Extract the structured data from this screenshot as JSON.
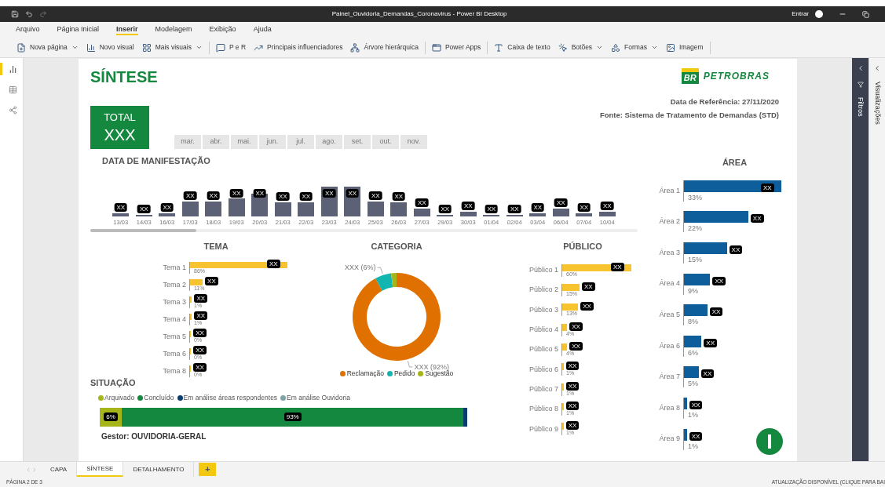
{
  "window": {
    "title": "Painel_Ouvidoria_Demandas_Coronavirus - Power BI Desktop",
    "account": "Entrar"
  },
  "menu": [
    {
      "label": "Arquivo",
      "selected": false
    },
    {
      "label": "Página Inicial",
      "selected": false
    },
    {
      "label": "Inserir",
      "selected": true
    },
    {
      "label": "Modelagem",
      "selected": false
    },
    {
      "label": "Exibição",
      "selected": false
    },
    {
      "label": "Ajuda",
      "selected": false
    }
  ],
  "ribbon": [
    {
      "label": "Nova página",
      "dropdown": true
    },
    {
      "label": "Novo visual",
      "dropdown": false
    },
    {
      "label": "Mais visuais",
      "dropdown": true
    },
    {
      "label": "P e R",
      "dropdown": false
    },
    {
      "label": "Principais influenciadores",
      "dropdown": false
    },
    {
      "label": "Árvore hierárquica",
      "dropdown": false
    },
    {
      "label": "Power Apps",
      "dropdown": false
    },
    {
      "label": "Caixa de texto",
      "dropdown": false
    },
    {
      "label": "Botões",
      "dropdown": true
    },
    {
      "label": "Formas",
      "dropdown": true
    },
    {
      "label": "Imagem",
      "dropdown": false
    }
  ],
  "rail": [
    {
      "selected": true
    },
    {
      "selected": false
    },
    {
      "selected": false
    }
  ],
  "page": {
    "title": "SÍNTESE",
    "total": {
      "label": "TOTAL",
      "value": "XXX"
    },
    "months": [
      {
        "label": "mar.",
        "selected": false
      },
      {
        "label": "abr.",
        "selected": false
      },
      {
        "label": "mai.",
        "selected": false
      },
      {
        "label": "jun.",
        "selected": false
      },
      {
        "label": "jul.",
        "selected": false
      },
      {
        "label": "ago.",
        "selected": false
      },
      {
        "label": "set.",
        "selected": false
      },
      {
        "label": "out.",
        "selected": false
      },
      {
        "label": "nov.",
        "selected": false
      }
    ],
    "logo": {
      "mark": "BR",
      "name": "PETROBRAS"
    },
    "reference": "Data de Referência: 27/11/2020",
    "source": "Fonte: Sistema de Tratamento de Demandas (STD)",
    "date_chart": {
      "title": "DATA DE MANIFESTAÇÃO",
      "columns": [
        {
          "date": "13/03",
          "label": "XX"
        },
        {
          "date": "14/03",
          "label": "XX"
        },
        {
          "date": "16/03",
          "label": "XX"
        },
        {
          "date": "17/03",
          "label": "XX"
        },
        {
          "date": "18/03",
          "label": "XX"
        },
        {
          "date": "19/03",
          "label": "XX"
        },
        {
          "date": "20/03",
          "label": "XX"
        },
        {
          "date": "21/03",
          "label": "XX"
        },
        {
          "date": "22/03",
          "label": "XX"
        },
        {
          "date": "23/03",
          "label": "XX"
        },
        {
          "date": "24/03",
          "label": "XX"
        },
        {
          "date": "25/03",
          "label": "XX"
        },
        {
          "date": "26/03",
          "label": "XX"
        },
        {
          "date": "27/03",
          "label": "XX"
        },
        {
          "date": "29/03",
          "label": "XX"
        },
        {
          "date": "30/03",
          "label": "XX"
        },
        {
          "date": "01/04",
          "label": "XX"
        },
        {
          "date": "02/04",
          "label": "XX"
        },
        {
          "date": "03/04",
          "label": "XX"
        },
        {
          "date": "06/04",
          "label": "XX"
        },
        {
          "date": "07/04",
          "label": "XX"
        },
        {
          "date": "10/04",
          "label": "XX"
        }
      ]
    },
    "tema": {
      "title": "TEMA",
      "bars": [
        {
          "name": "Tema 1",
          "label": "XX",
          "percent": "86%",
          "level": 1
        },
        {
          "name": "Tema 2",
          "label": "XX",
          "percent": "11%",
          "level": 0.13
        },
        {
          "name": "Tema 3",
          "label": "XX",
          "percent": "1%",
          "level": 0.02
        },
        {
          "name": "Tema 4",
          "label": "XX",
          "percent": "1%",
          "level": 0.02
        },
        {
          "name": "Tema 5",
          "label": "XX",
          "percent": "0%",
          "level": 0.01
        },
        {
          "name": "Tema 6",
          "label": "XX",
          "percent": "0%",
          "level": 0.01
        },
        {
          "name": "Tema 8",
          "label": "XX",
          "percent": "0%",
          "level": 0.01
        }
      ]
    },
    "categoria": {
      "title": "CATEGORIA",
      "segments": [
        {
          "name": "Reclamação",
          "color": "#e07000",
          "callout": "XXX (92%)"
        },
        {
          "name": "Pedido",
          "color": "#12b5b0",
          "callout": "XXX (6%)"
        },
        {
          "name": "Sugestão",
          "color": "#a5b51a"
        }
      ]
    },
    "publico": {
      "title": "PÚBLICO",
      "bars": [
        {
          "name": "Público 1",
          "label": "XX",
          "percent": "60%",
          "level": 1
        },
        {
          "name": "Público 2",
          "label": "XX",
          "percent": "15%",
          "level": 0.25
        },
        {
          "name": "Público 3",
          "label": "XX",
          "percent": "13%",
          "level": 0.23
        },
        {
          "name": "Público 4",
          "label": "XX",
          "percent": "4%",
          "level": 0.07
        },
        {
          "name": "Público 5",
          "label": "XX",
          "percent": "4%",
          "level": 0.07
        },
        {
          "name": "Público 6",
          "label": "XX",
          "percent": "1%",
          "level": 0.02
        },
        {
          "name": "Público 7",
          "label": "XX",
          "percent": "1%",
          "level": 0.02
        },
        {
          "name": "Público 8",
          "label": "XX",
          "percent": "1%",
          "level": 0.02
        },
        {
          "name": "Público 9",
          "label": "XX",
          "percent": "1%",
          "level": 0.02
        }
      ]
    },
    "situacao": {
      "title": "SITUAÇÃO",
      "segments": [
        {
          "name": "Arquivado",
          "color": "#a5b51a",
          "label": "6%"
        },
        {
          "name": "Concluído",
          "color": "#14883e",
          "label": "93%"
        },
        {
          "name": "Em análise áreas respondentes",
          "color": "#0d3c6e"
        },
        {
          "name": "Em análise Ouvidoria",
          "color": "#7ea4a8"
        }
      ]
    },
    "manager": "Gestor: OUVIDORIA-GERAL",
    "area": {
      "title": "ÁREA",
      "bars": [
        {
          "name": "Área 1",
          "label": "XX",
          "percent": "33%",
          "level": 1
        },
        {
          "name": "Área 2",
          "label": "XX",
          "percent": "22%",
          "level": 0.66
        },
        {
          "name": "Área 3",
          "label": "XX",
          "percent": "15%",
          "level": 0.44
        },
        {
          "name": "Área 4",
          "label": "XX",
          "percent": "9%",
          "level": 0.27
        },
        {
          "name": "Área 5",
          "label": "XX",
          "percent": "8%",
          "level": 0.24
        },
        {
          "name": "Área 6",
          "label": "XX",
          "percent": "6%",
          "level": 0.18
        },
        {
          "name": "Área 7",
          "label": "XX",
          "percent": "5%",
          "level": 0.15
        },
        {
          "name": "Área 8",
          "label": "XX",
          "percent": "1%",
          "level": 0.03
        },
        {
          "name": "Área 9",
          "label": "XX",
          "percent": "1%",
          "level": 0.03
        }
      ]
    }
  },
  "panes": [
    {
      "label": "Filtros",
      "kind": "filters"
    },
    {
      "label": "Visualizações",
      "kind": "visualizations"
    }
  ],
  "tabs": [
    {
      "label": "CAPA",
      "selected": false
    },
    {
      "label": "SÍNTESE",
      "selected": true
    },
    {
      "label": "DETALHAMENTO",
      "selected": false
    }
  ],
  "add_tab": "+",
  "status": {
    "page": "PÁGINA 2 DE 3",
    "update": "ATUALIZAÇÃO DISPONÍVEL (CLIQUE PARA BAI"
  }
}
